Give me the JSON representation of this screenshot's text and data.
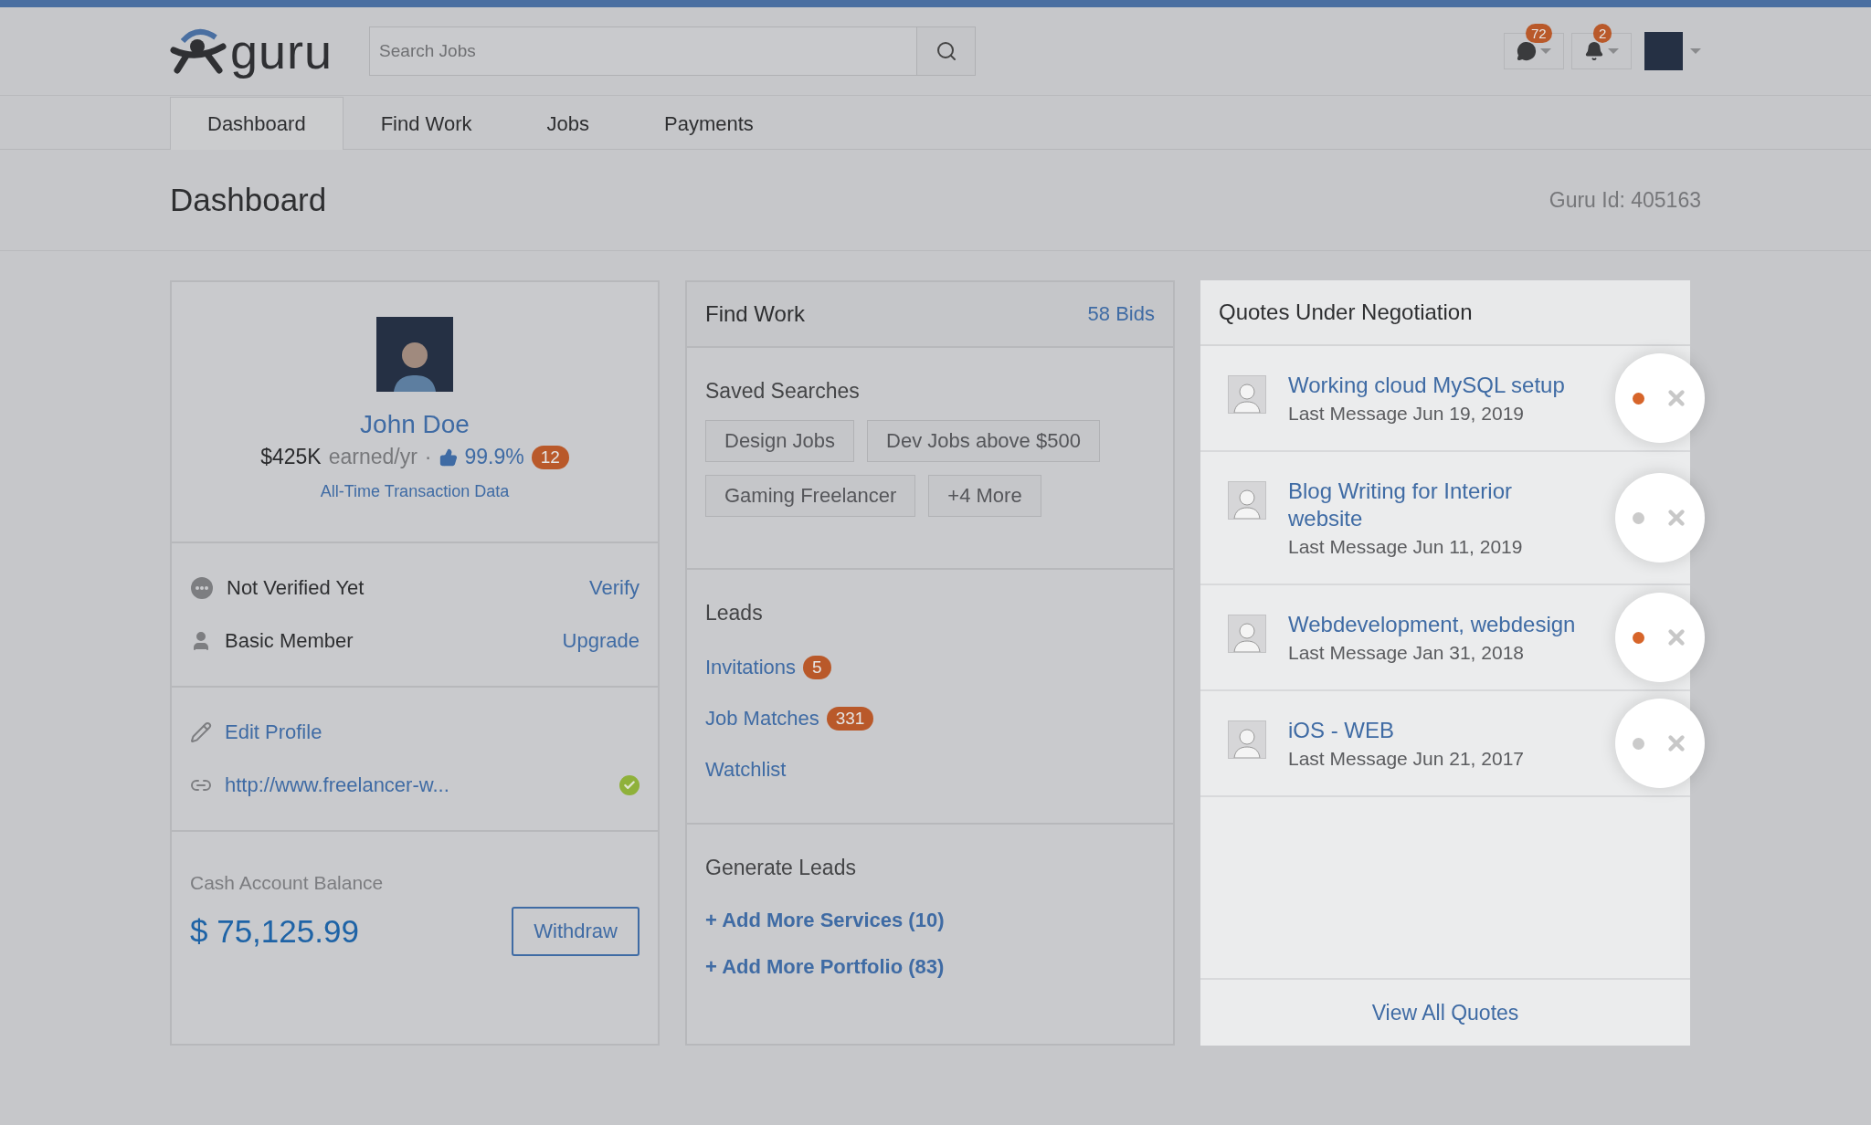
{
  "header": {
    "logo": "guru",
    "search": {
      "placeholder": "Search Jobs"
    },
    "messages_badge": "72",
    "notifications_badge": "2"
  },
  "tabs": [
    {
      "label": "Dashboard",
      "selected": true
    },
    {
      "label": "Find Work",
      "selected": false
    },
    {
      "label": "Jobs",
      "selected": false
    },
    {
      "label": "Payments",
      "selected": false
    }
  ],
  "page": {
    "title": "Dashboard",
    "guru_id": "Guru Id: 405163"
  },
  "profile": {
    "name": "John Doe",
    "earnings": "$425K",
    "earnings_label": "earned/yr",
    "separator": "·",
    "rating": "99.9%",
    "reviews_badge": "12",
    "transactions_link": "All-Time Transaction Data",
    "status_rows": [
      {
        "kind": "verify",
        "label": "Not Verified Yet",
        "action": "Verify"
      },
      {
        "kind": "member",
        "label": "Basic Member",
        "action": "Upgrade"
      }
    ],
    "edit_profile": "Edit Profile",
    "website": {
      "url": "http://www.freelancer-w...",
      "verified": true
    },
    "balance_label": "Cash Account Balance",
    "balance": "$ 75,125.99",
    "withdraw": "Withdraw"
  },
  "find_work": {
    "title": "Find Work",
    "bids": "58 Bids",
    "saved_searches_title": "Saved Searches",
    "saved_searches": [
      "Design Jobs",
      "Dev Jobs above $500",
      "Gaming Freelancer",
      "+4 More"
    ],
    "leads_title": "Leads",
    "leads": [
      {
        "label": "Invitations",
        "count": "5"
      },
      {
        "label": "Job Matches",
        "count": "331"
      },
      {
        "label": "Watchlist"
      }
    ],
    "generate_leads_title": "Generate Leads",
    "generate_leads": [
      "+ Add More Services (10)",
      "+ Add More Portfolio (83)"
    ]
  },
  "quotes": {
    "title": "Quotes Under Negotiation",
    "footer": "View All Quotes",
    "items": [
      {
        "title": "Working cloud MySQL setup",
        "last_message": "Last Message Jun 19, 2019",
        "unread": true
      },
      {
        "title": "Blog Writing for Interior website",
        "last_message": "Last Message Jun 11, 2019",
        "unread": false
      },
      {
        "title": "Webdevelopment, webdesign",
        "last_message": "Last Message Jan 31, 2018",
        "unread": true
      },
      {
        "title": "iOS - WEB",
        "last_message": "Last Message Jun 21, 2017",
        "unread": false
      }
    ]
  }
}
